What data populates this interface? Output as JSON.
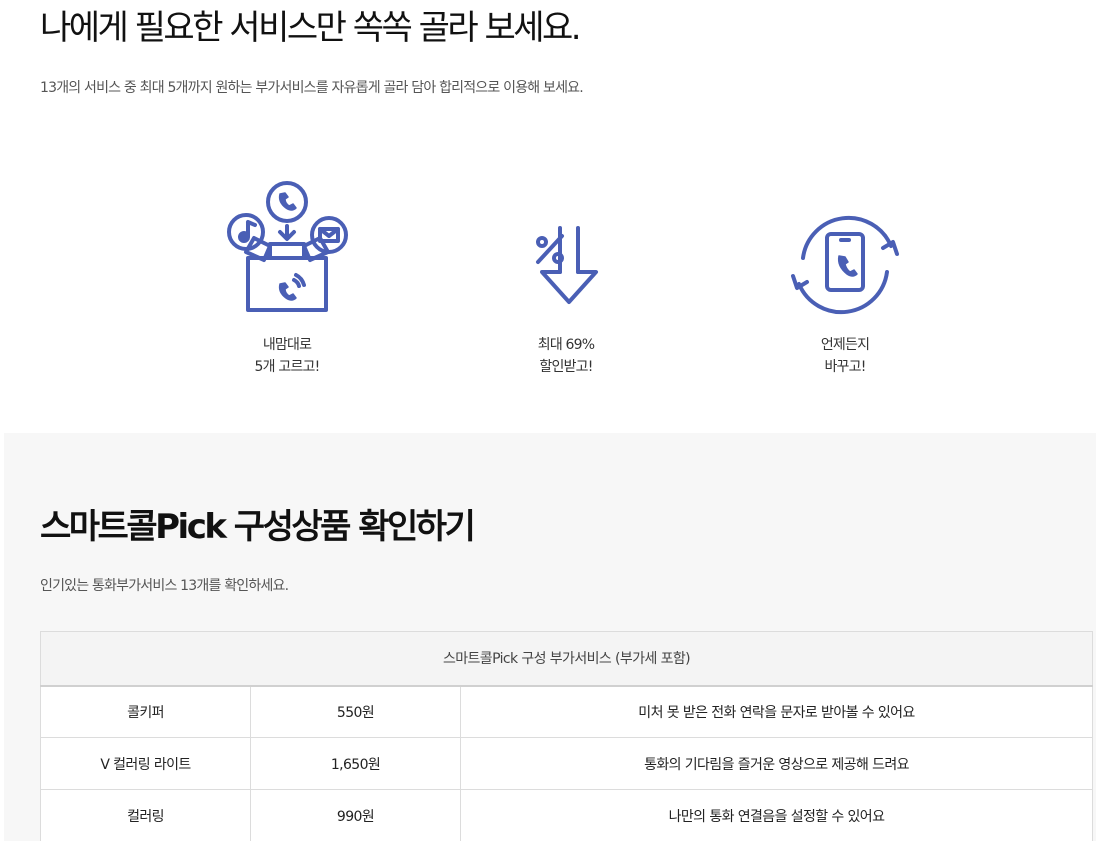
{
  "hero": {
    "title": "나에게 필요한 서비스만 쏙쏙 골라 보세요.",
    "subtitle": "13개의 서비스 중 최대 5개까지 원하는 부가서비스를 자유롭게 골라 담아 합리적으로 이용해 보세요."
  },
  "features": [
    {
      "icon": "gift-box-icon",
      "line1": "내맘대로",
      "line2": "5개 고르고!"
    },
    {
      "icon": "discount-arrow-icon",
      "line1": "최대 69%",
      "line2": "할인받고!"
    },
    {
      "icon": "phone-refresh-icon",
      "line1": "언제든지",
      "line2": "바꾸고!"
    }
  ],
  "section": {
    "title": "스마트콜Pick 구성상품 확인하기",
    "subtitle": "인기있는 통화부가서비스 13개를 확인하세요."
  },
  "table": {
    "header": "스마트콜Pick 구성 부가서비스 (부가세 포함)",
    "rows": [
      {
        "name": "콜키퍼",
        "price": "550원",
        "desc": "미처 못 받은 전화 연락을 문자로 받아볼 수 있어요"
      },
      {
        "name": "V 컬러링 라이트",
        "price": "1,650원",
        "desc": "통화의 기다림을 즐거운 영상으로 제공해 드려요"
      },
      {
        "name": "컬러링",
        "price": "990원",
        "desc": "나만의 통화 연결음을 설정할 수 있어요"
      }
    ]
  },
  "colors": {
    "accent": "#4a5fb5"
  }
}
